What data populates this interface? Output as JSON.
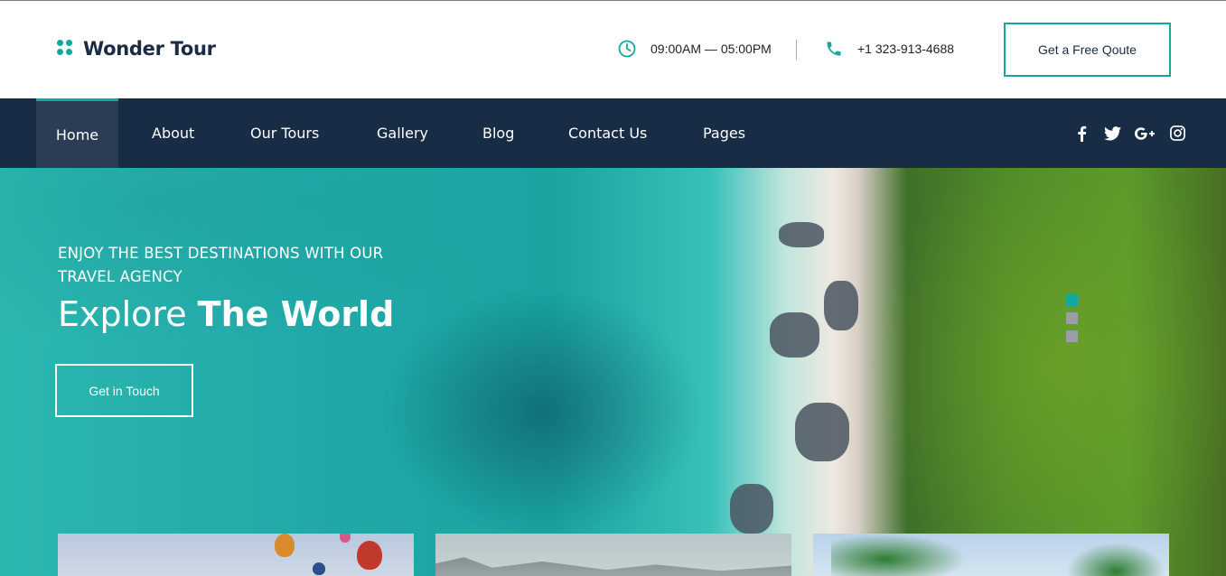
{
  "header": {
    "logo_text": "Wonder Tour",
    "hours": "09:00AM — 05:00PM",
    "phone": "+1 323-913-4688",
    "quote_button": "Get a Free Qoute"
  },
  "nav": {
    "items": [
      {
        "label": "Home",
        "active": true
      },
      {
        "label": "About"
      },
      {
        "label": "Our Tours"
      },
      {
        "label": "Gallery"
      },
      {
        "label": "Blog"
      },
      {
        "label": "Contact Us"
      },
      {
        "label": "Pages"
      }
    ],
    "socials": [
      "facebook-icon",
      "twitter-icon",
      "google-plus-icon",
      "instagram-icon"
    ]
  },
  "hero": {
    "subtitle": "ENJOY THE BEST DESTINATIONS WITH OUR TRAVEL AGENCY",
    "title_light": "Explore ",
    "title_bold": "The World",
    "button": "Get in Touch",
    "slides": 3,
    "active_slide": 0
  },
  "colors": {
    "accent": "#13a89e",
    "navy": "#182c45",
    "nav_active": "#2a3d55"
  }
}
